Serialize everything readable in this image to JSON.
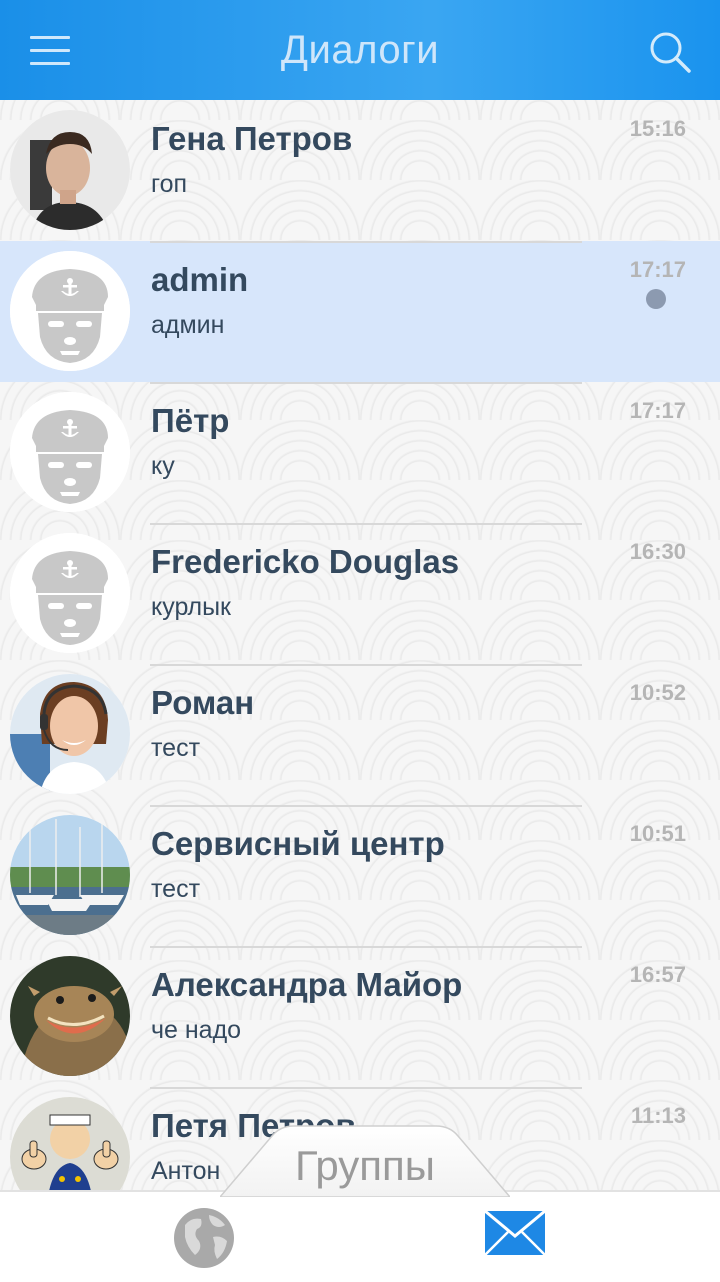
{
  "header": {
    "title": "Диалоги",
    "menu_icon": "hamburger-menu-icon",
    "search_icon": "search-icon",
    "color": "#2196f3"
  },
  "dialogs": [
    {
      "name": "Гена Петров",
      "message": "гоп",
      "time": "15:16",
      "avatar": "photo-man"
    },
    {
      "name": "admin",
      "message": "админ",
      "time": "17:17",
      "avatar": "sailor-default",
      "selected": true,
      "unread": true
    },
    {
      "name": "Пётр",
      "message": "ку",
      "time": "17:17",
      "avatar": "sailor-default"
    },
    {
      "name": "Fredericko Douglas",
      "message": "курлык",
      "time": "16:30",
      "avatar": "sailor-default"
    },
    {
      "name": "Роман",
      "message": "тест",
      "time": "10:52",
      "avatar": "photo-support-woman"
    },
    {
      "name": "Сервисный центр",
      "message": "тест",
      "time": "10:51",
      "avatar": "photo-boats"
    },
    {
      "name": "Александра Майор",
      "message": "че надо",
      "time": "16:57",
      "avatar": "photo-lizard"
    },
    {
      "name": "Петя Петров",
      "message": "Антон",
      "time": "11:13",
      "avatar": "photo-popeye"
    }
  ],
  "groups_tab": {
    "label": "Группы"
  },
  "bottom_nav": {
    "left_icon": "globe-icon",
    "right_icon": "mail-icon",
    "accent": "#1e88e5"
  }
}
